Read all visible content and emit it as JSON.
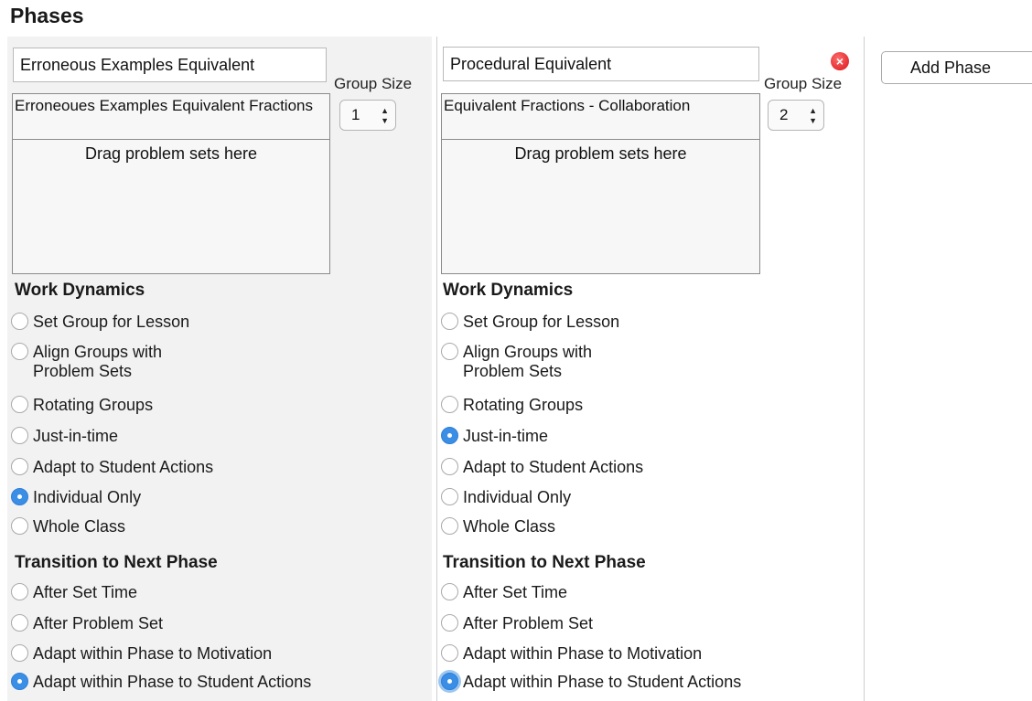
{
  "page": {
    "title": "Phases",
    "add_phase_label": "Add Phase"
  },
  "phases": [
    {
      "name": "Erroneous Examples Equivalent",
      "group_size_label": "Group Size",
      "group_size": "1",
      "problem_sets": [
        "Erroneoues Examples Equivalent Fractions"
      ],
      "drag_hint": "Drag problem sets here",
      "deletable": false,
      "work_dynamics_title": "Work Dynamics",
      "work_dynamics": [
        {
          "label": "Set Group for Lesson",
          "checked": false
        },
        {
          "label": "Align Groups with\nProblem Sets",
          "checked": false
        },
        {
          "label": "Rotating Groups",
          "checked": false
        },
        {
          "label": "Just-in-time",
          "checked": false
        },
        {
          "label": "Adapt to Student Actions",
          "checked": false
        },
        {
          "label": "Individual Only",
          "checked": true
        },
        {
          "label": "Whole Class",
          "checked": false
        }
      ],
      "transition_title": "Transition to Next Phase",
      "transition": [
        {
          "label": "After Set Time",
          "checked": false
        },
        {
          "label": "After Problem Set",
          "checked": false
        },
        {
          "label": "Adapt within Phase to Motivation",
          "checked": false
        },
        {
          "label": "Adapt within Phase to Student Actions",
          "checked": true
        }
      ]
    },
    {
      "name": "Procedural Equivalent",
      "group_size_label": "Group Size",
      "group_size": "2",
      "problem_sets": [
        "Equivalent Fractions - Collaboration"
      ],
      "drag_hint": "Drag problem sets here",
      "deletable": true,
      "work_dynamics_title": "Work Dynamics",
      "work_dynamics": [
        {
          "label": "Set Group for Lesson",
          "checked": false
        },
        {
          "label": "Align Groups with\nProblem Sets",
          "checked": false
        },
        {
          "label": "Rotating Groups",
          "checked": false
        },
        {
          "label": "Just-in-time",
          "checked": true
        },
        {
          "label": "Adapt to Student Actions",
          "checked": false
        },
        {
          "label": "Individual Only",
          "checked": false
        },
        {
          "label": "Whole Class",
          "checked": false
        }
      ],
      "transition_title": "Transition to Next Phase",
      "transition": [
        {
          "label": "After Set Time",
          "checked": false
        },
        {
          "label": "After Problem Set",
          "checked": false
        },
        {
          "label": "Adapt within Phase to Motivation",
          "checked": false
        },
        {
          "label": "Adapt within Phase to Student Actions",
          "checked": true,
          "focused": true
        }
      ]
    }
  ],
  "icons": {
    "delete": "close-circle-icon",
    "select_arrows": "updown-arrows-icon"
  },
  "colors": {
    "accent": "#3a8ee6",
    "delete": "#d8141a",
    "panel_bg": "#f2f2f2"
  }
}
